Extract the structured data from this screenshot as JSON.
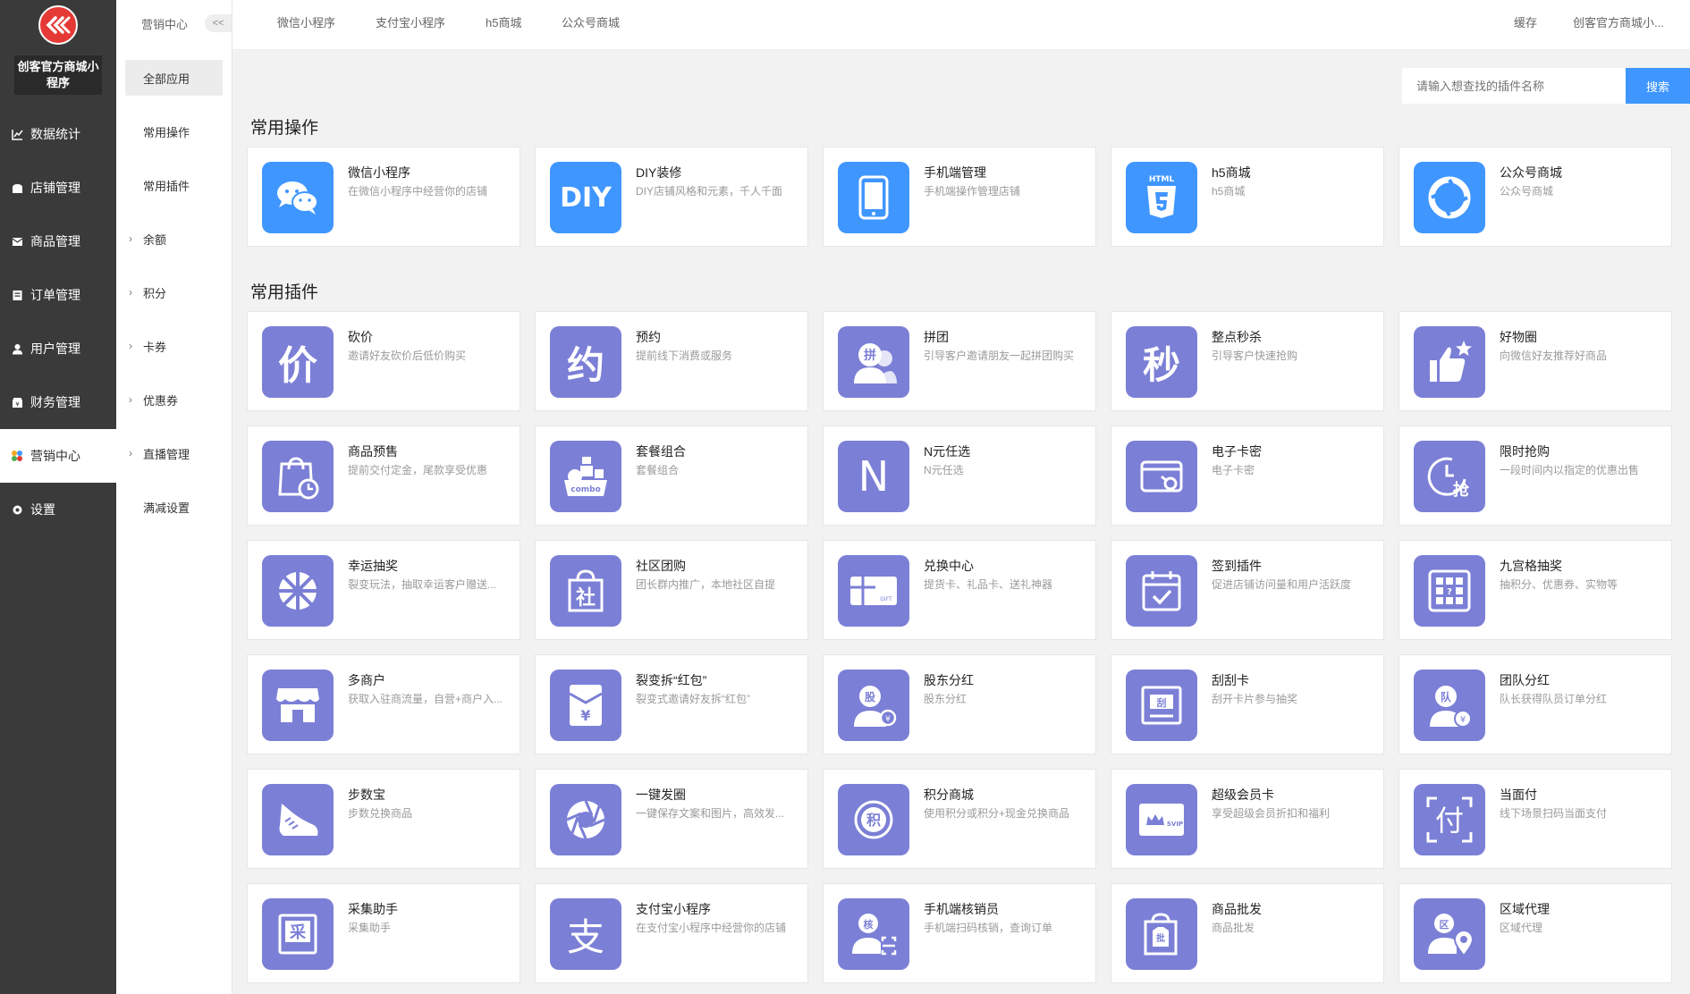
{
  "sidebar": {
    "shop_name": "创客官方商城小程序",
    "items": [
      {
        "label": "数据统计",
        "icon": "chart-icon"
      },
      {
        "label": "店铺管理",
        "icon": "store-icon"
      },
      {
        "label": "商品管理",
        "icon": "goods-icon"
      },
      {
        "label": "订单管理",
        "icon": "order-icon"
      },
      {
        "label": "用户管理",
        "icon": "user-icon"
      },
      {
        "label": "财务管理",
        "icon": "finance-icon"
      },
      {
        "label": "营销中心",
        "icon": "marketing-icon",
        "active": true
      },
      {
        "label": "设置",
        "icon": "settings-icon"
      }
    ]
  },
  "subnav": {
    "header": "营销中心",
    "collapse": "<<",
    "items": [
      {
        "label": "全部应用",
        "active": true
      },
      {
        "label": "常用操作"
      },
      {
        "label": "常用插件"
      },
      {
        "label": "余额",
        "chevron": true
      },
      {
        "label": "积分",
        "chevron": true
      },
      {
        "label": "卡券",
        "chevron": true
      },
      {
        "label": "优惠券",
        "chevron": true
      },
      {
        "label": "直播管理",
        "chevron": true
      },
      {
        "label": "满减设置"
      }
    ]
  },
  "topbar": {
    "tabs": [
      "微信小程序",
      "支付宝小程序",
      "h5商城",
      "公众号商城"
    ],
    "cache": "缓存",
    "account": "创客官方商城小..."
  },
  "search": {
    "placeholder": "请输入想查找的插件名称",
    "button": "搜索"
  },
  "sections": {
    "common_ops": "常用操作",
    "common_plugins": "常用插件"
  },
  "common_ops": [
    {
      "title": "微信小程序",
      "desc": "在微信小程序中经营你的店铺",
      "icon": "wechat-icon"
    },
    {
      "title": "DIY装修",
      "desc": "DIY店铺风格和元素，千人千面",
      "icon": "diy-icon"
    },
    {
      "title": "手机端管理",
      "desc": "手机端操作管理店铺",
      "icon": "phone-icon"
    },
    {
      "title": "h5商城",
      "desc": "h5商城",
      "icon": "html5-icon"
    },
    {
      "title": "公众号商城",
      "desc": "公众号商城",
      "icon": "shutter-icon"
    }
  ],
  "plugins": [
    {
      "title": "砍价",
      "desc": "邀请好友砍价后低价购买",
      "icon": "bargain-icon"
    },
    {
      "title": "预约",
      "desc": "提前线下消费或服务",
      "icon": "appointment-icon"
    },
    {
      "title": "拼团",
      "desc": "引导客户邀请朋友一起拼团购买",
      "icon": "group-buy-icon"
    },
    {
      "title": "整点秒杀",
      "desc": "引导客户快速抢购",
      "icon": "flash-sale-icon"
    },
    {
      "title": "好物圈",
      "desc": "向微信好友推荐好商品",
      "icon": "thumbs-up-icon"
    },
    {
      "title": "商品预售",
      "desc": "提前交付定金，尾款享受优惠",
      "icon": "presale-bag-icon"
    },
    {
      "title": "套餐组合",
      "desc": "套餐组合",
      "icon": "combo-icon"
    },
    {
      "title": "N元任选",
      "desc": "N元任选",
      "icon": "n-letter-icon"
    },
    {
      "title": "电子卡密",
      "desc": "电子卡密",
      "icon": "e-card-icon"
    },
    {
      "title": "限时抢购",
      "desc": "一段时间内以指定的优惠出售",
      "icon": "clock-grab-icon"
    },
    {
      "title": "幸运抽奖",
      "desc": "裂变玩法，抽取幸运客户赠送...",
      "icon": "wheel-icon"
    },
    {
      "title": "社区团购",
      "desc": "团长群内推广，本地社区自提",
      "icon": "community-bag-icon"
    },
    {
      "title": "兑换中心",
      "desc": "提货卡、礼品卡、送礼神器",
      "icon": "gift-card-icon"
    },
    {
      "title": "签到插件",
      "desc": "促进店铺访问量和用户活跃度",
      "icon": "calendar-check-icon"
    },
    {
      "title": "九宫格抽奖",
      "desc": "抽积分、优惠券、实物等",
      "icon": "grid-lottery-icon"
    },
    {
      "title": "多商户",
      "desc": "获取入驻商流量，自营+商户入...",
      "icon": "storefront-icon"
    },
    {
      "title": "裂变拆“红包”",
      "desc": "裂变式邀请好友拆“红包”",
      "icon": "red-envelope-icon"
    },
    {
      "title": "股东分红",
      "desc": "股东分红",
      "icon": "shareholder-icon"
    },
    {
      "title": "刮刮卡",
      "desc": "刮开卡片参与抽奖",
      "icon": "scratch-card-icon"
    },
    {
      "title": "团队分红",
      "desc": "队长获得队员订单分红",
      "icon": "team-bonus-icon"
    },
    {
      "title": "步数宝",
      "desc": "步数兑换商品",
      "icon": "sneaker-icon"
    },
    {
      "title": "一键发圈",
      "desc": "一键保存文案和图片，高效发...",
      "icon": "aperture-icon"
    },
    {
      "title": "积分商城",
      "desc": "使用积分或积分+现金兑换商品",
      "icon": "points-icon"
    },
    {
      "title": "超级会员卡",
      "desc": "享受超级会员折扣和福利",
      "icon": "svip-card-icon"
    },
    {
      "title": "当面付",
      "desc": "线下场景扫码当面支付",
      "icon": "pay-scan-icon"
    },
    {
      "title": "采集助手",
      "desc": "采集助手",
      "icon": "collect-icon"
    },
    {
      "title": "支付宝小程序",
      "desc": "在支付宝小程序中经营你的店铺",
      "icon": "alipay-icon"
    },
    {
      "title": "手机端核销员",
      "desc": "手机端扫码核销，查询订单",
      "icon": "verifier-icon"
    },
    {
      "title": "商品批发",
      "desc": "商品批发",
      "icon": "wholesale-icon"
    },
    {
      "title": "区域代理",
      "desc": "区域代理",
      "icon": "region-agent-icon"
    }
  ],
  "glyphs": {
    "diy": "DIY",
    "html": "HTML",
    "bargain": "价",
    "appointment": "约",
    "group": "拼",
    "flash": "秒",
    "combo": "combo",
    "n": "N",
    "grab": "抢",
    "community": "社",
    "gift": "GIFT",
    "lottery": "?",
    "envelope": "¥",
    "shareholder": "股",
    "scratch": "刮",
    "team": "队",
    "points": "积",
    "svip": "SVIP",
    "pay": "付",
    "collect": "采",
    "alipay": "支",
    "verify": "核",
    "wholesale": "批",
    "region": "区"
  },
  "colors": {
    "sidebar_bg": "#3a3a3a",
    "accent_blue": "#3f96ff",
    "plugin_purple": "#7b7fd6",
    "logo_red": "#e53935"
  }
}
